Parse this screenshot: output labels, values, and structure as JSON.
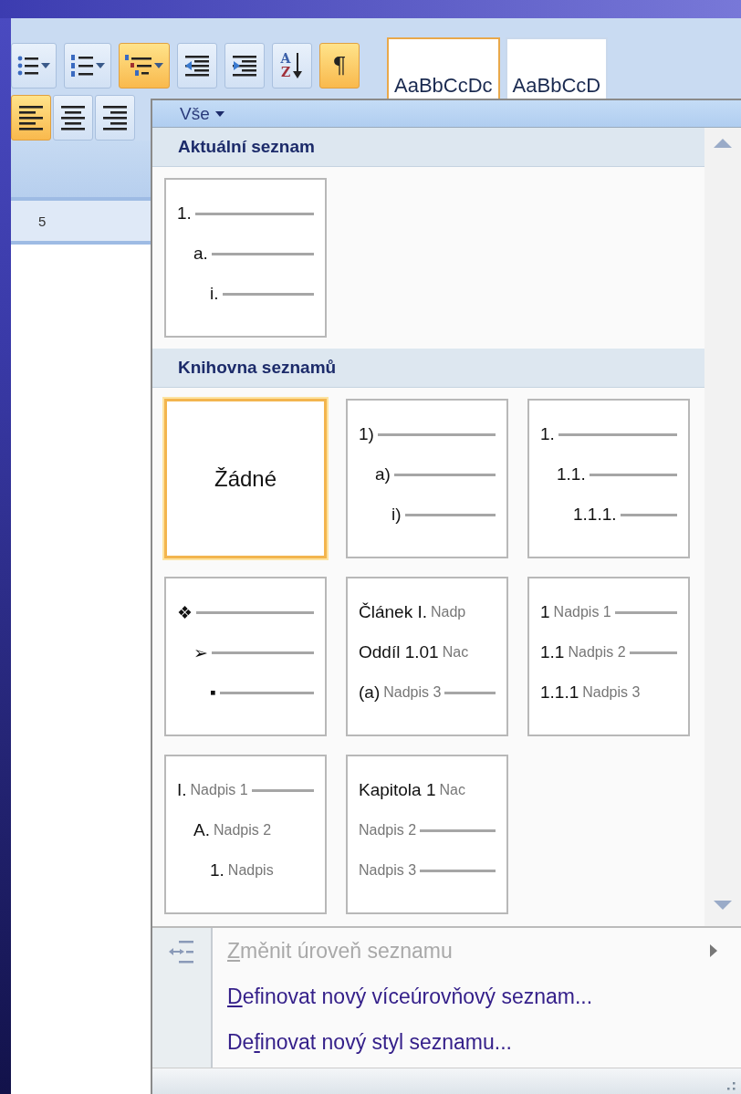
{
  "ribbon": {
    "paragraph_row": [
      {
        "kind": "bullets",
        "active": false,
        "dropdown": true
      },
      {
        "kind": "numbering",
        "active": false,
        "dropdown": true
      },
      {
        "kind": "multilevel",
        "active": true,
        "dropdown": true
      },
      {
        "kind": "decrease_indent",
        "active": false,
        "dropdown": false
      },
      {
        "kind": "increase_indent",
        "active": false,
        "dropdown": false
      },
      {
        "kind": "sort",
        "active": false,
        "dropdown": false,
        "letters": [
          "A",
          "Z"
        ]
      },
      {
        "kind": "pilcrow",
        "active": true,
        "dropdown": false,
        "label": "¶"
      }
    ],
    "align_row": [
      {
        "kind": "align_left",
        "active": true
      },
      {
        "kind": "center",
        "active": false
      },
      {
        "kind": "align_right",
        "active": false
      }
    ],
    "styles": [
      {
        "sample": "AaBbCcDc",
        "selected": true
      },
      {
        "sample": "AaBbCcD",
        "selected": false
      }
    ]
  },
  "ruler": {
    "mark": "5"
  },
  "menu": {
    "filter": "Vše",
    "sections": [
      {
        "title": "Aktuální seznam",
        "tiles": [
          {
            "kind": "stepped",
            "selected": false,
            "lines": [
              {
                "marker": "1.",
                "rule": true
              },
              {
                "marker": "a.",
                "rule": true
              },
              {
                "marker": "i.",
                "rule": true
              }
            ]
          }
        ]
      },
      {
        "title": "Knihovna seznamů",
        "tiles": [
          {
            "kind": "none",
            "selected": true,
            "label": "Žádné"
          },
          {
            "kind": "stepped",
            "selected": false,
            "lines": [
              {
                "marker": "1)",
                "rule": true
              },
              {
                "marker": "a)",
                "rule": true
              },
              {
                "marker": "i)",
                "rule": true
              }
            ]
          },
          {
            "kind": "stepped",
            "selected": false,
            "lines": [
              {
                "marker": "1.",
                "rule": true
              },
              {
                "marker": "1.1.",
                "rule": true
              },
              {
                "marker": "1.1.1.",
                "rule": true
              }
            ]
          },
          {
            "kind": "stepped",
            "selected": false,
            "lines": [
              {
                "marker": "❖",
                "rule": true
              },
              {
                "marker": "➢",
                "rule": true
              },
              {
                "marker": "▪",
                "rule": true
              }
            ]
          },
          {
            "kind": "flat",
            "selected": false,
            "lines": [
              {
                "marker": "Článek I.",
                "caption": "Nadp",
                "rule": false
              },
              {
                "marker": "Oddíl 1.01",
                "caption": "Nac",
                "rule": false
              },
              {
                "marker": "(a)",
                "caption": "Nadpis 3",
                "rule": true
              }
            ]
          },
          {
            "kind": "flat",
            "selected": false,
            "lines": [
              {
                "marker": "1",
                "caption": "Nadpis 1",
                "rule": true
              },
              {
                "marker": "1.1",
                "caption": "Nadpis 2",
                "rule": true
              },
              {
                "marker": "1.1.1",
                "caption": "Nadpis 3",
                "rule": false
              }
            ]
          },
          {
            "kind": "stepped",
            "selected": false,
            "lines": [
              {
                "marker": "I.",
                "caption": "Nadpis 1",
                "rule": true
              },
              {
                "marker": "A.",
                "caption": "Nadpis 2",
                "rule": false
              },
              {
                "marker": "1.",
                "caption": "Nadpis",
                "rule": false
              }
            ]
          },
          {
            "kind": "flat",
            "selected": false,
            "lines": [
              {
                "marker": "Kapitola 1",
                "caption": "Nac",
                "rule": false
              },
              {
                "caption": "Nadpis 2",
                "rule": true
              },
              {
                "caption": "Nadpis 3",
                "rule": true
              }
            ]
          }
        ]
      }
    ],
    "commands": [
      {
        "label": "Změnit úroveň seznamu",
        "disabled": true,
        "submenu": true,
        "icon": true
      },
      {
        "label": "Definovat nový víceúrovňový seznam...",
        "disabled": false,
        "submenu": false,
        "icon": false
      },
      {
        "label": "Definovat nový styl seznamu...",
        "disabled": false,
        "submenu": false,
        "icon": false
      }
    ]
  }
}
